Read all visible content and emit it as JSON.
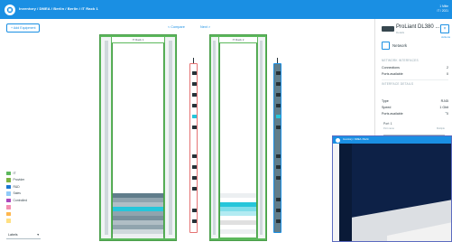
{
  "topbar": {
    "breadcrumb": "Inventory / DMEA / Berlin / Berlin / IT Rack 1",
    "user_line1": "1 Mitte",
    "user_line2": "IT / 2021"
  },
  "toolbar": {
    "add_equipment_label": "+ Add Equipment"
  },
  "rack_links": {
    "left": "< Compare",
    "right": "Next >"
  },
  "racks": [
    {
      "title": "IT Rack 1"
    },
    {
      "title": "IT Rack 2"
    }
  ],
  "legend": {
    "items": [
      {
        "label": "IT",
        "color": "#5cb85c"
      },
      {
        "label": "Provider",
        "color": "#7cb342"
      },
      {
        "label": "R&D",
        "color": "#1976d2"
      },
      {
        "label": "Sales",
        "color": "#90caf9"
      },
      {
        "label": "Controlled",
        "color": "#ab47bc"
      },
      {
        "label": "",
        "color": "#f48fb1"
      },
      {
        "label": "",
        "color": "#ffb74d"
      },
      {
        "label": "",
        "color": "#ffe082"
      }
    ]
  },
  "labels_select": {
    "value": "Labels"
  },
  "details": {
    "name": "ProLiant DL380 ...",
    "subtitle": "Details",
    "tab_label": "Actions",
    "network_label": "Network",
    "section_network": "NETWORK INTERFACES",
    "rows_network": [
      {
        "label": "Connections",
        "value": "2"
      },
      {
        "label": "Ports available",
        "value": "0"
      }
    ],
    "section_interfaces": "INTERFACE DETAILS",
    "rows_interface": [
      {
        "label": "Type",
        "value": "RJ45"
      },
      {
        "label": "Speed",
        "value": "1 Gbit"
      },
      {
        "label": "Ports available",
        "value": "0"
      }
    ],
    "port_heading": "Port 1",
    "port_field_label": "Port name",
    "port_field_hint": "Multiple"
  },
  "video": {
    "crumb": "Inventory / DMEA / Berlin"
  }
}
